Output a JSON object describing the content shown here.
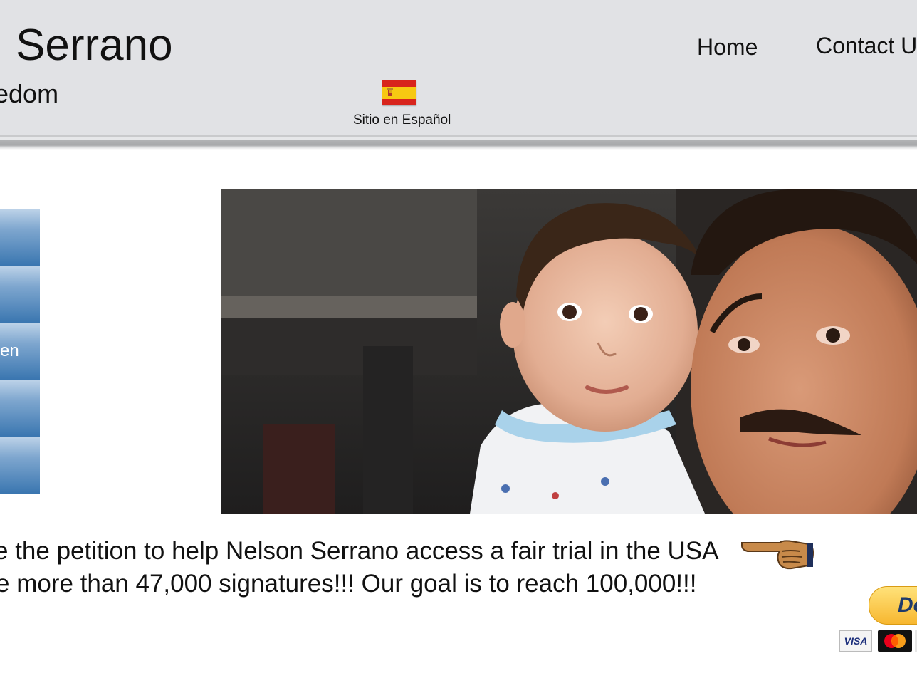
{
  "header": {
    "title": "Serrano",
    "subtitle": "edom",
    "nav": {
      "home": "Home",
      "contact": "Contact U"
    },
    "spanish_link": "Sitio en Español",
    "flag_icon": "spain-flag-icon"
  },
  "sidebar": {
    "items": [
      {
        "label": ""
      },
      {
        "label": ""
      },
      {
        "label": "en"
      },
      {
        "label": ""
      },
      {
        "label": ""
      }
    ]
  },
  "hero": {
    "photo_icon": "family-photo"
  },
  "petition": {
    "line1": "e the petition to help Nelson Serrano access a fair trial in the USA",
    "line2": "e more than 47,000 signatures!!! Our goal is to reach 100,000!!!",
    "pointer_icon": "pointing-hand-icon"
  },
  "donate": {
    "label": "Do",
    "cards": {
      "visa": "VISA"
    }
  },
  "colors": {
    "header_bg": "#e1e2e5",
    "sidebar_blue": "#3a76b0",
    "donate_yellow": "#f7b730"
  }
}
